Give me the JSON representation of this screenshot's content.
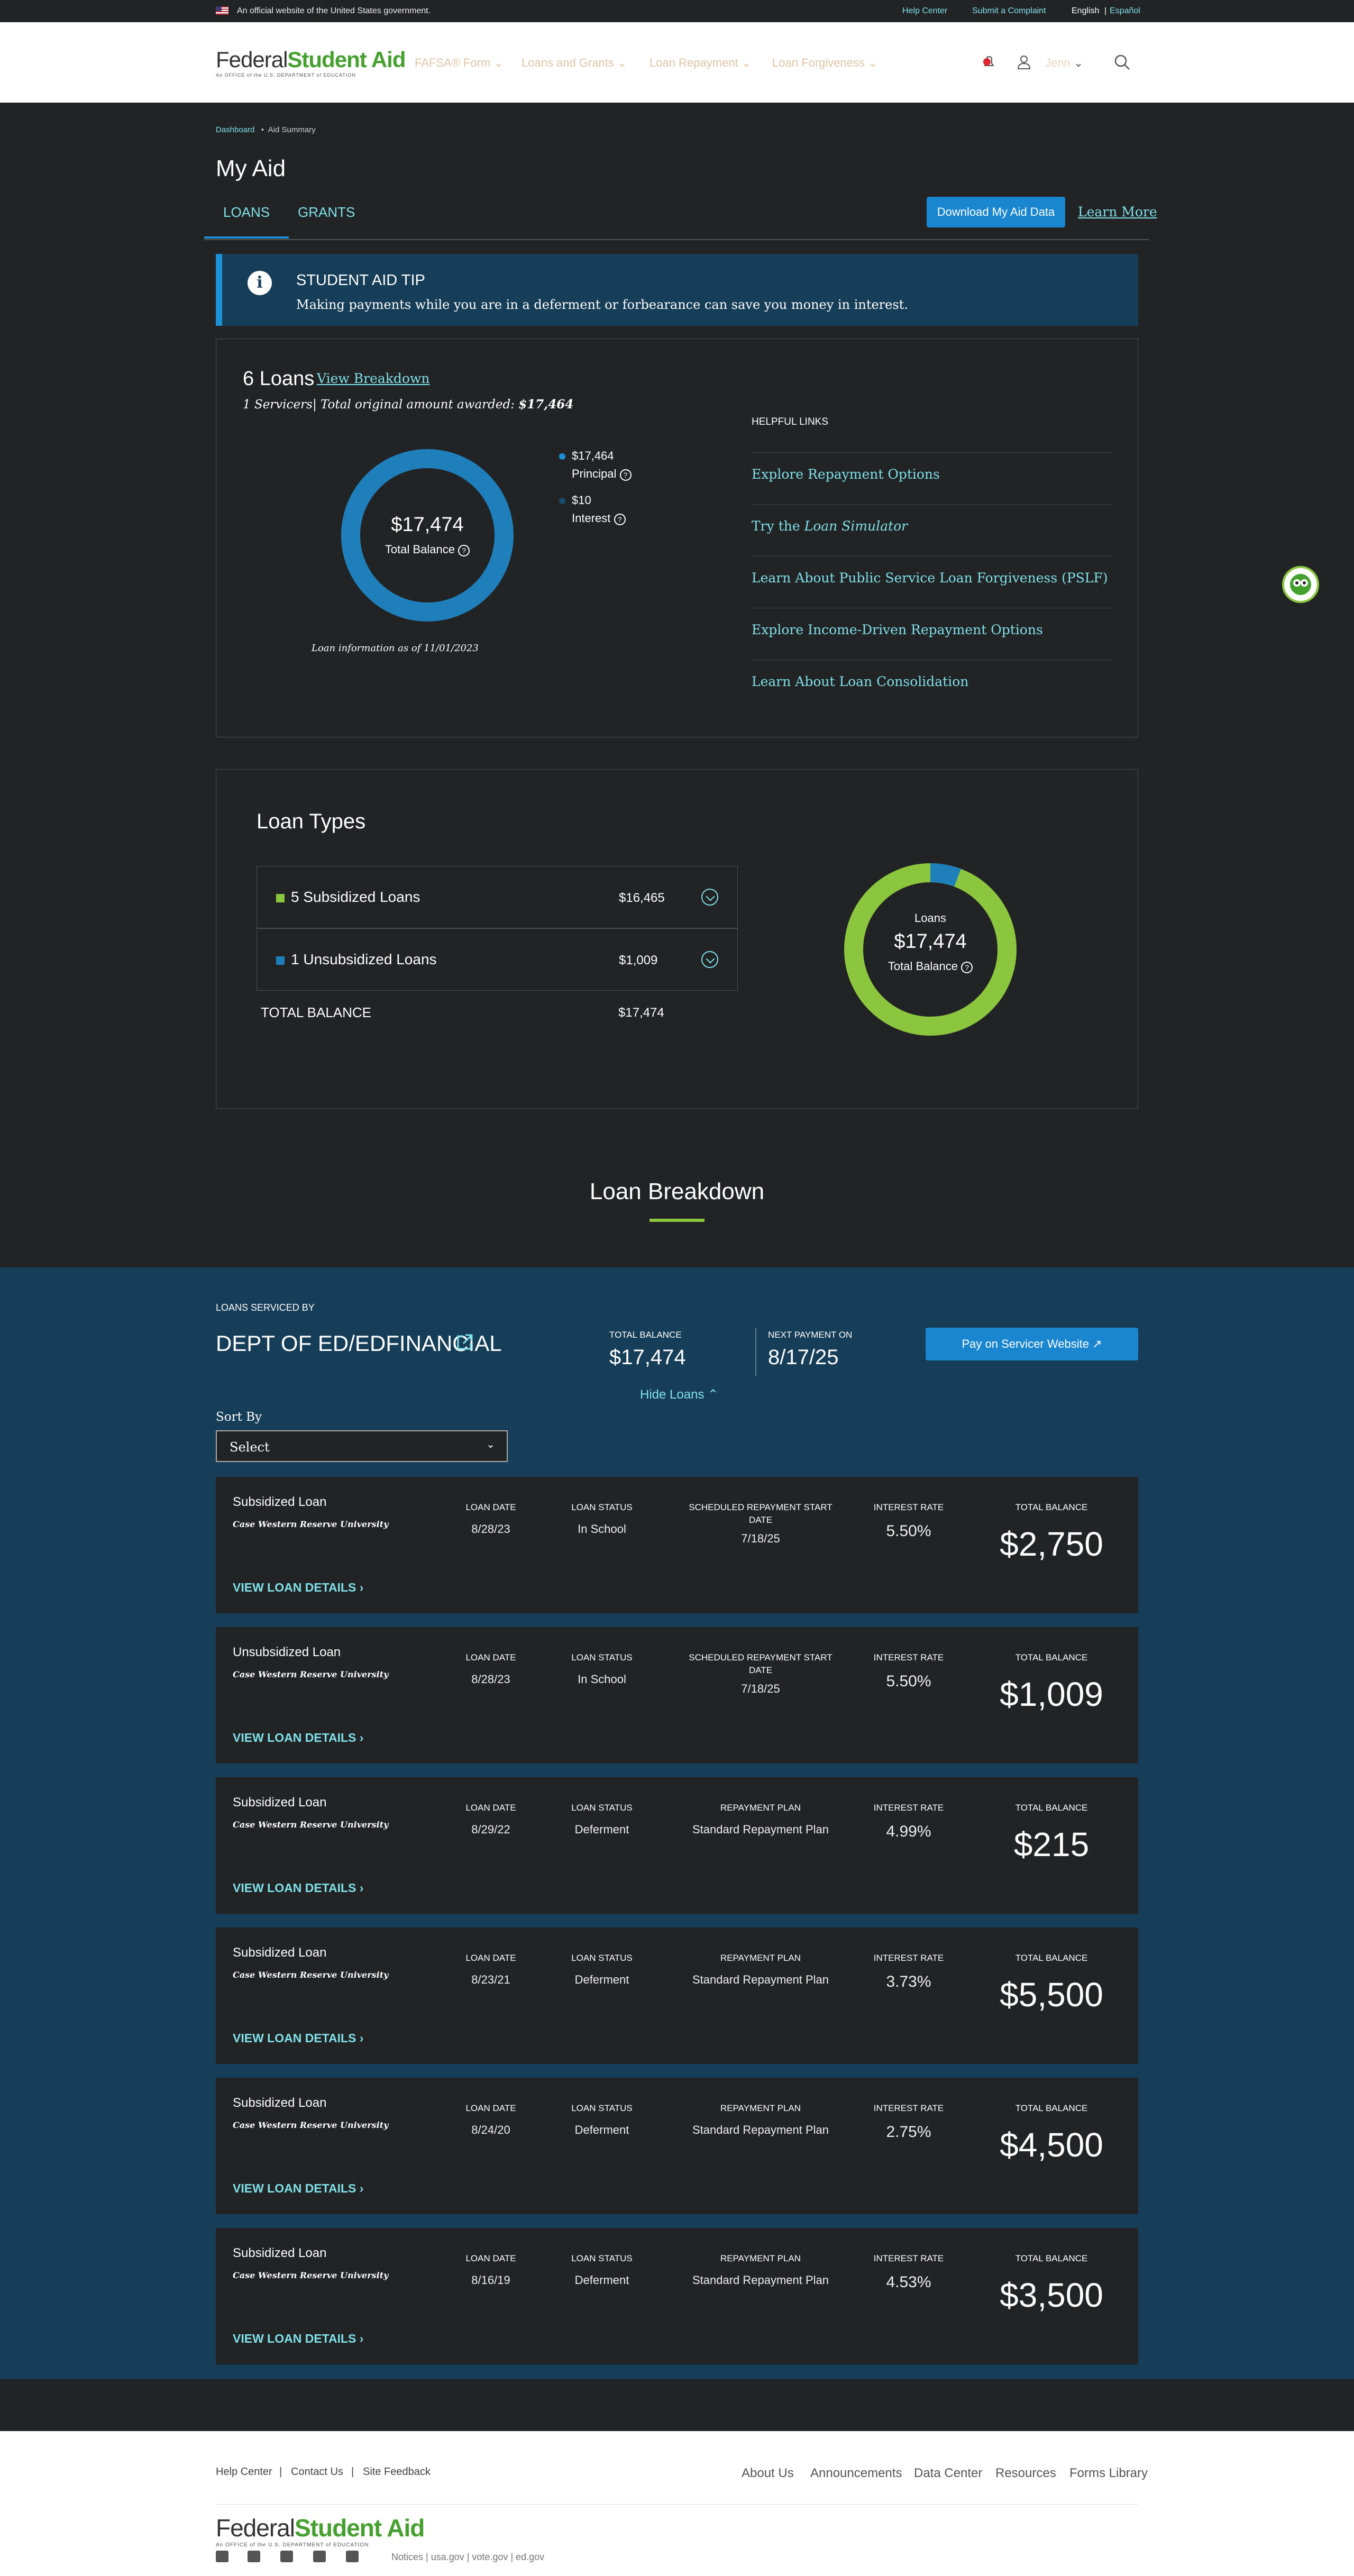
{
  "gov_banner": {
    "text": "An official website of the United States government.",
    "help_center": "Help Center",
    "submit_complaint": "Submit a Complaint",
    "english": "English",
    "sep": "|",
    "espanol": "Español"
  },
  "header": {
    "logo_federal": "Federal",
    "logo_student_aid": "Student Aid",
    "logo_sub": "An OFFICE of the U.S. DEPARTMENT of EDUCATION",
    "nav": [
      "FAFSA® Form",
      "Loans and Grants",
      "Loan Repayment",
      "Loan Forgiveness"
    ],
    "user": "Jenn"
  },
  "breadcrumb": {
    "home": "Dashboard",
    "current": "Aid Summary"
  },
  "page_title": "My Aid",
  "tabs": [
    "LOANS",
    "GRANTS"
  ],
  "download_button": "Download My Aid Data",
  "learn_more": "Learn More",
  "tip": {
    "title": "STUDENT AID TIP",
    "text": "Making payments while you are in a deferment or forbearance can save you money in interest."
  },
  "summary": {
    "loan_count": "6 Loans",
    "view_breakdown": "View Breakdown",
    "servicers_line": "1 Servicers| Total original amount awarded:",
    "total_awarded": "$17,464",
    "donut_amount": "$17,474",
    "donut_label": "Total Balance",
    "principal_amount": "$17,464",
    "principal_label": "Principal",
    "interest_amount": "$10",
    "interest_label": "Interest",
    "as_of": "Loan information as of 11/01/2023",
    "chart_principal_share": 0.9994,
    "colors": {
      "principal": "#1e7fba",
      "interest": "#1e90d6"
    }
  },
  "helpful_links": {
    "title": "HELPFUL LINKS",
    "items": [
      "Explore Repayment Options",
      "Try the ",
      "Learn About Public Service Loan Forgiveness (PSLF)",
      "Explore Income-Driven Repayment Options",
      "Learn About Loan Consolidation"
    ],
    "simulator_italic": "Loan Simulator"
  },
  "loan_types": {
    "title": "Loan Types",
    "rows": [
      {
        "label": "5 Subsidized Loans",
        "amount": "$16,465",
        "color": "#8cc63f"
      },
      {
        "label": "1 Unsubsidized Loans",
        "amount": "$1,009",
        "color": "#1e7fba"
      }
    ],
    "total_label": "TOTAL BALANCE",
    "total_amount": "$17,474",
    "donut_top": "Loans",
    "donut_amount": "$17,474",
    "donut_label": "Total Balance",
    "subsidized_share": 0.9423
  },
  "breakdown_title": "Loan Breakdown",
  "servicer": {
    "label": "LOANS SERVICED BY",
    "name": "DEPT OF ED/EDFINANCIAL",
    "total_balance_label": "TOTAL BALANCE",
    "total_balance": "$17,474",
    "next_payment_label": "NEXT PAYMENT ON",
    "next_payment": "8/17/25",
    "pay_button": "Pay on Servicer Website",
    "hide_loans": "Hide Loans",
    "sort_by": "Sort By",
    "sort_value": "Select"
  },
  "loan_headers": {
    "loan_date": "LOAN DATE",
    "loan_status": "LOAN STATUS",
    "sched_l1": "SCHEDULED REPAYMENT START",
    "sched_l2": "DATE",
    "repayment_plan": "REPAYMENT PLAN",
    "interest_rate": "INTEREST RATE",
    "total_balance": "TOTAL BALANCE",
    "view_details": "VIEW LOAN DETAILS"
  },
  "loans": [
    {
      "type": "Subsidized Loan",
      "school": "Case Western Reserve University",
      "date": "8/28/23",
      "status": "In School",
      "third": "7/18/25",
      "rate": "5.50%",
      "balance": "$2,750"
    },
    {
      "type": "Unsubsidized Loan",
      "school": "Case Western Reserve University",
      "date": "8/28/23",
      "status": "In School",
      "third": "7/18/25",
      "rate": "5.50%",
      "balance": "$1,009"
    },
    {
      "type": "Subsidized Loan",
      "school": "Case Western Reserve University",
      "date": "8/29/22",
      "status": "Deferment",
      "third": "Standard Repayment Plan",
      "rate": "4.99%",
      "balance": "$215"
    },
    {
      "type": "Subsidized Loan",
      "school": "Case Western Reserve University",
      "date": "8/23/21",
      "status": "Deferment",
      "third": "Standard Repayment Plan",
      "rate": "3.73%",
      "balance": "$5,500"
    },
    {
      "type": "Subsidized Loan",
      "school": "Case Western Reserve University",
      "date": "8/24/20",
      "status": "Deferment",
      "third": "Standard Repayment Plan",
      "rate": "2.75%",
      "balance": "$4,500"
    },
    {
      "type": "Subsidized Loan",
      "school": "Case Western Reserve University",
      "date": "8/16/19",
      "status": "Deferment",
      "third": "Standard Repayment Plan",
      "rate": "4.53%",
      "balance": "$3,500"
    }
  ],
  "footer": {
    "left_links": [
      "Help Center",
      "Contact Us",
      "Site Feedback"
    ],
    "right_links": [
      "About Us",
      "Announcements",
      "Data Center",
      "Resources",
      "Forms Library"
    ],
    "bottom_links": "Notices | usa.gov | vote.gov | ed.gov",
    "social": [
      "twitter-icon",
      "facebook-icon",
      "instagram-icon",
      "linkedin-icon",
      "youtube-icon"
    ]
  }
}
